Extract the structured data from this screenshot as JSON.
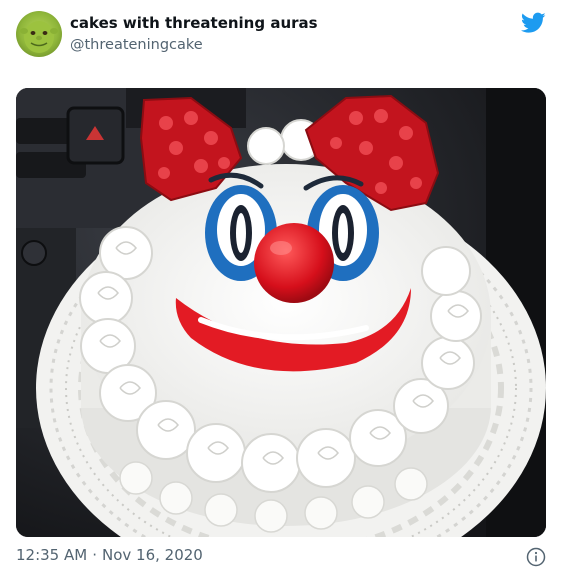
{
  "tweet": {
    "display_name": "cakes with threatening auras",
    "handle": "@threateningcake",
    "time": "12:35 AM",
    "separator": "·",
    "date": "Nov 16, 2020"
  },
  "icons": {
    "avatar": "shrek-avatar",
    "brand": "twitter-bird-icon",
    "info": "info-icon"
  },
  "colors": {
    "twitter_blue": "#1d9bf0",
    "text_primary": "#0f1419",
    "text_secondary": "#536471"
  }
}
